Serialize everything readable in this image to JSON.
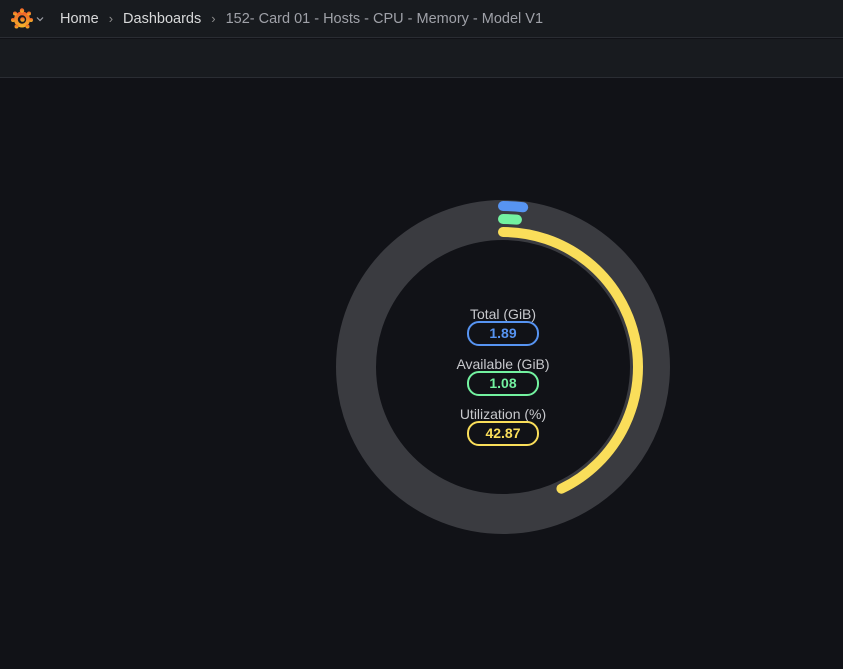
{
  "breadcrumb": {
    "items": [
      {
        "label": "Home"
      },
      {
        "label": "Dashboards"
      }
    ],
    "separator": "›",
    "current": "152- Card 01 - Hosts - CPU - Memory - Model V1"
  },
  "icons": {
    "logo": "grafana-logo-icon",
    "menu_caret": "chevron-down-icon"
  },
  "gauge": {
    "track_color": "#3a3b40",
    "series": [
      {
        "label": "Total (GiB)",
        "value": "1.89",
        "color": "#5794f2",
        "fraction": 0.02
      },
      {
        "label": "Available (GiB)",
        "value": "1.08",
        "color": "#73f2a0",
        "fraction": 0.015
      },
      {
        "label": "Utilization (%)",
        "value": "42.87",
        "color": "#fade5a",
        "fraction": 0.4287
      }
    ]
  }
}
